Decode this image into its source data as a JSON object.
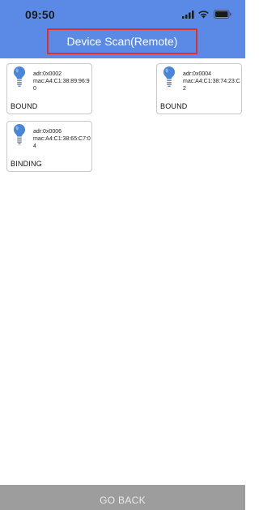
{
  "status_bar": {
    "time": "09:50"
  },
  "header": {
    "title": "Device Scan(Remote)",
    "background_color": "#5a8ae6",
    "highlight_color": "#e0302a"
  },
  "devices": [
    {
      "adr": "adr:0x0002",
      "mac": "mac:A4:C1:38:89:96:90",
      "status": "BOUND",
      "icon": "lightbulb-icon"
    },
    {
      "adr": "adr:0x0004",
      "mac": "mac:A4:C1:38:74:23:C2",
      "status": "BOUND",
      "icon": "lightbulb-icon"
    },
    {
      "adr": "adr:0x0006",
      "mac": "mac:A4:C1:38:65:C7:04",
      "status": "BINDING",
      "icon": "lightbulb-icon"
    }
  ],
  "footer": {
    "go_back_label": "GO BACK",
    "background_color": "#9d9d9d"
  }
}
